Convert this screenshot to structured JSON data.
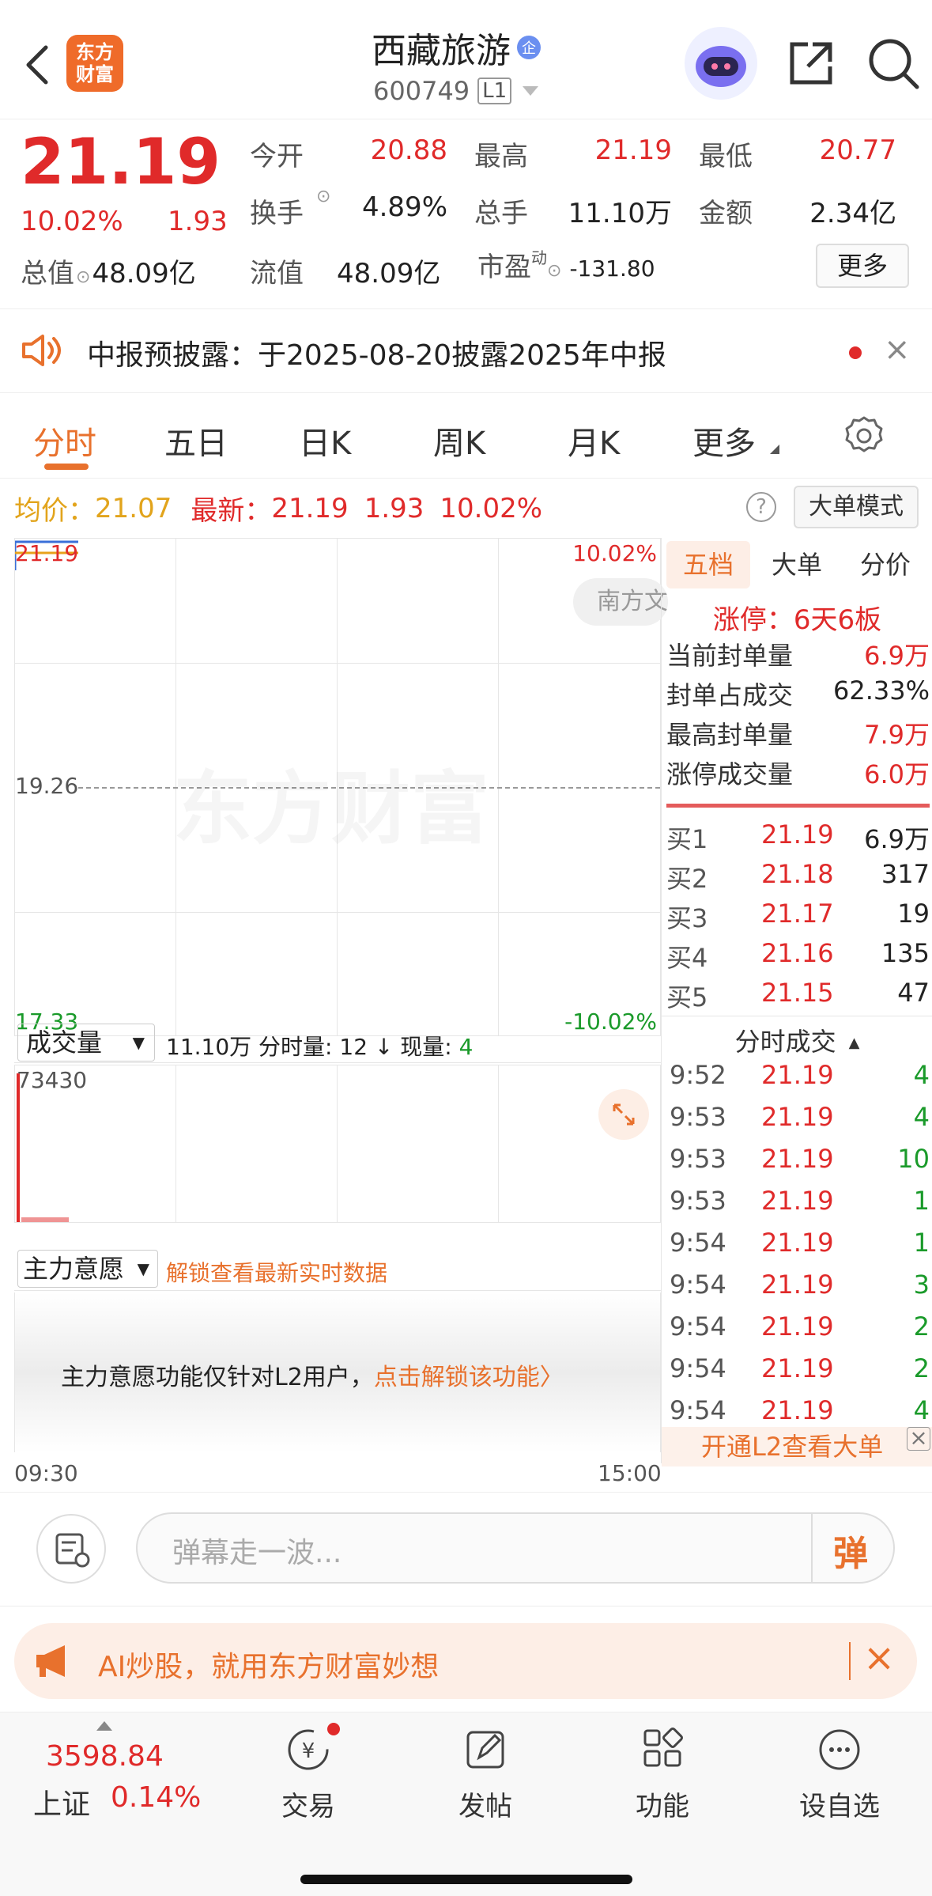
{
  "header": {
    "title": "西藏旅游",
    "badge": "企",
    "code": "600749",
    "level": "L1",
    "logo_line1": "东方",
    "logo_line2": "财富"
  },
  "quote": {
    "price": "21.19",
    "pct": "10.02%",
    "change": "1.93",
    "stats": [
      {
        "label": "今开",
        "value": "20.88",
        "color": "red"
      },
      {
        "label": "最高",
        "value": "21.19",
        "color": "red"
      },
      {
        "label": "最低",
        "value": "20.77",
        "color": "red"
      },
      {
        "label": "换手",
        "value": "4.89%",
        "color": "dark"
      },
      {
        "label": "总手",
        "value": "11.10万",
        "color": "dark"
      },
      {
        "label": "金额",
        "value": "2.34亿",
        "color": "dark"
      }
    ],
    "total_label": "总值",
    "total_value": "48.09亿",
    "float_label": "流值",
    "float_value": "48.09亿",
    "pe_label": "市盈",
    "pe_sup": "动",
    "pe_value": "-131.80",
    "more": "更多"
  },
  "notice": {
    "text": "中报预披露：于2025-08-20披露2025年中报"
  },
  "tabs": [
    "分时",
    "五日",
    "日K",
    "周K",
    "月K",
    "更多"
  ],
  "infobar": {
    "avg_label": "均价：",
    "avg": "21.07",
    "last_label": "最新：",
    "last": "21.19",
    "chg": "1.93",
    "pct": "10.02%",
    "big_mode": "大单模式"
  },
  "chart": {
    "ymax": "21.19",
    "ymid": "19.26",
    "ymin": "17.33",
    "pmax": "10.02%",
    "pmin": "-10.02%",
    "watermark": "东方财富",
    "chip": "南方文",
    "t_start": "09:30",
    "t_end": "15:00"
  },
  "vol": {
    "select": "成交量",
    "summary": "11.10万 分时量: 12 ↓ 现量: ",
    "now": "4",
    "max": "73430"
  },
  "main_force": {
    "select": "主力意愿",
    "unlock": "解锁查看最新实时数据",
    "body": "主力意愿功能仅针对L2用户，",
    "link": "点击解锁该功能〉"
  },
  "side": {
    "tabs": [
      "五档",
      "大单",
      "分价"
    ],
    "limit": "涨停：6天6板",
    "seal": [
      {
        "k": "当前封单量",
        "v": "6.9万",
        "c": "red"
      },
      {
        "k": "封单占成交",
        "v": "62.33%",
        "c": "dark"
      },
      {
        "k": "最高封单量",
        "v": "7.9万",
        "c": "red"
      },
      {
        "k": "涨停成交量",
        "v": "6.0万",
        "c": "red"
      }
    ],
    "bids": [
      {
        "k": "买1",
        "p": "21.19",
        "q": "6.9万"
      },
      {
        "k": "买2",
        "p": "21.18",
        "q": "317"
      },
      {
        "k": "买3",
        "p": "21.17",
        "q": "19"
      },
      {
        "k": "买4",
        "p": "21.16",
        "q": "135"
      },
      {
        "k": "买5",
        "p": "21.15",
        "q": "47"
      }
    ],
    "ticks_title": "分时成交",
    "ticks": [
      {
        "t": "9:52",
        "p": "21.19",
        "q": "4"
      },
      {
        "t": "9:53",
        "p": "21.19",
        "q": "4"
      },
      {
        "t": "9:53",
        "p": "21.19",
        "q": "10"
      },
      {
        "t": "9:53",
        "p": "21.19",
        "q": "1"
      },
      {
        "t": "9:54",
        "p": "21.19",
        "q": "1"
      },
      {
        "t": "9:54",
        "p": "21.19",
        "q": "3"
      },
      {
        "t": "9:54",
        "p": "21.19",
        "q": "2"
      },
      {
        "t": "9:54",
        "p": "21.19",
        "q": "2"
      },
      {
        "t": "9:54",
        "p": "21.19",
        "q": "4"
      }
    ],
    "l2": "开通L2查看大单"
  },
  "danmaku": {
    "placeholder": "弹幕走一波...",
    "btn": "弹"
  },
  "ad": {
    "text": "AI炒股，就用东方财富妙想"
  },
  "bottom": {
    "index": "3598.84",
    "index_name": "上证",
    "index_pct": "0.14%",
    "items": [
      {
        "label": "交易"
      },
      {
        "label": "发帖"
      },
      {
        "label": "功能"
      },
      {
        "label": "设自选"
      }
    ]
  }
}
